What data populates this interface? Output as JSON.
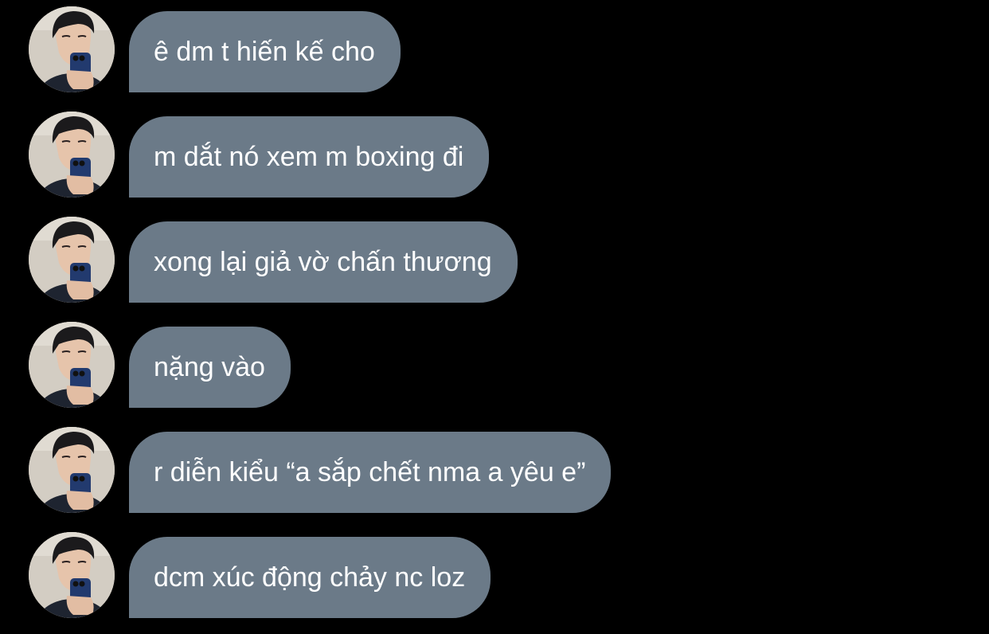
{
  "colors": {
    "background": "#000000",
    "bubble": "#6b7a88",
    "text": "#ffffff"
  },
  "messages": [
    {
      "text": "ê dm t hiến kế cho",
      "avatar": "profile-photo"
    },
    {
      "text": "m dắt nó xem m boxing đi",
      "avatar": "profile-photo"
    },
    {
      "text": "xong lại giả vờ chấn thương",
      "avatar": "profile-photo"
    },
    {
      "text": "nặng vào",
      "avatar": "profile-photo"
    },
    {
      "text": "r diễn kiểu “a sắp chết nma a yêu e”",
      "avatar": "profile-photo"
    },
    {
      "text": "dcm xúc động chảy nc loz",
      "avatar": "profile-photo"
    }
  ]
}
